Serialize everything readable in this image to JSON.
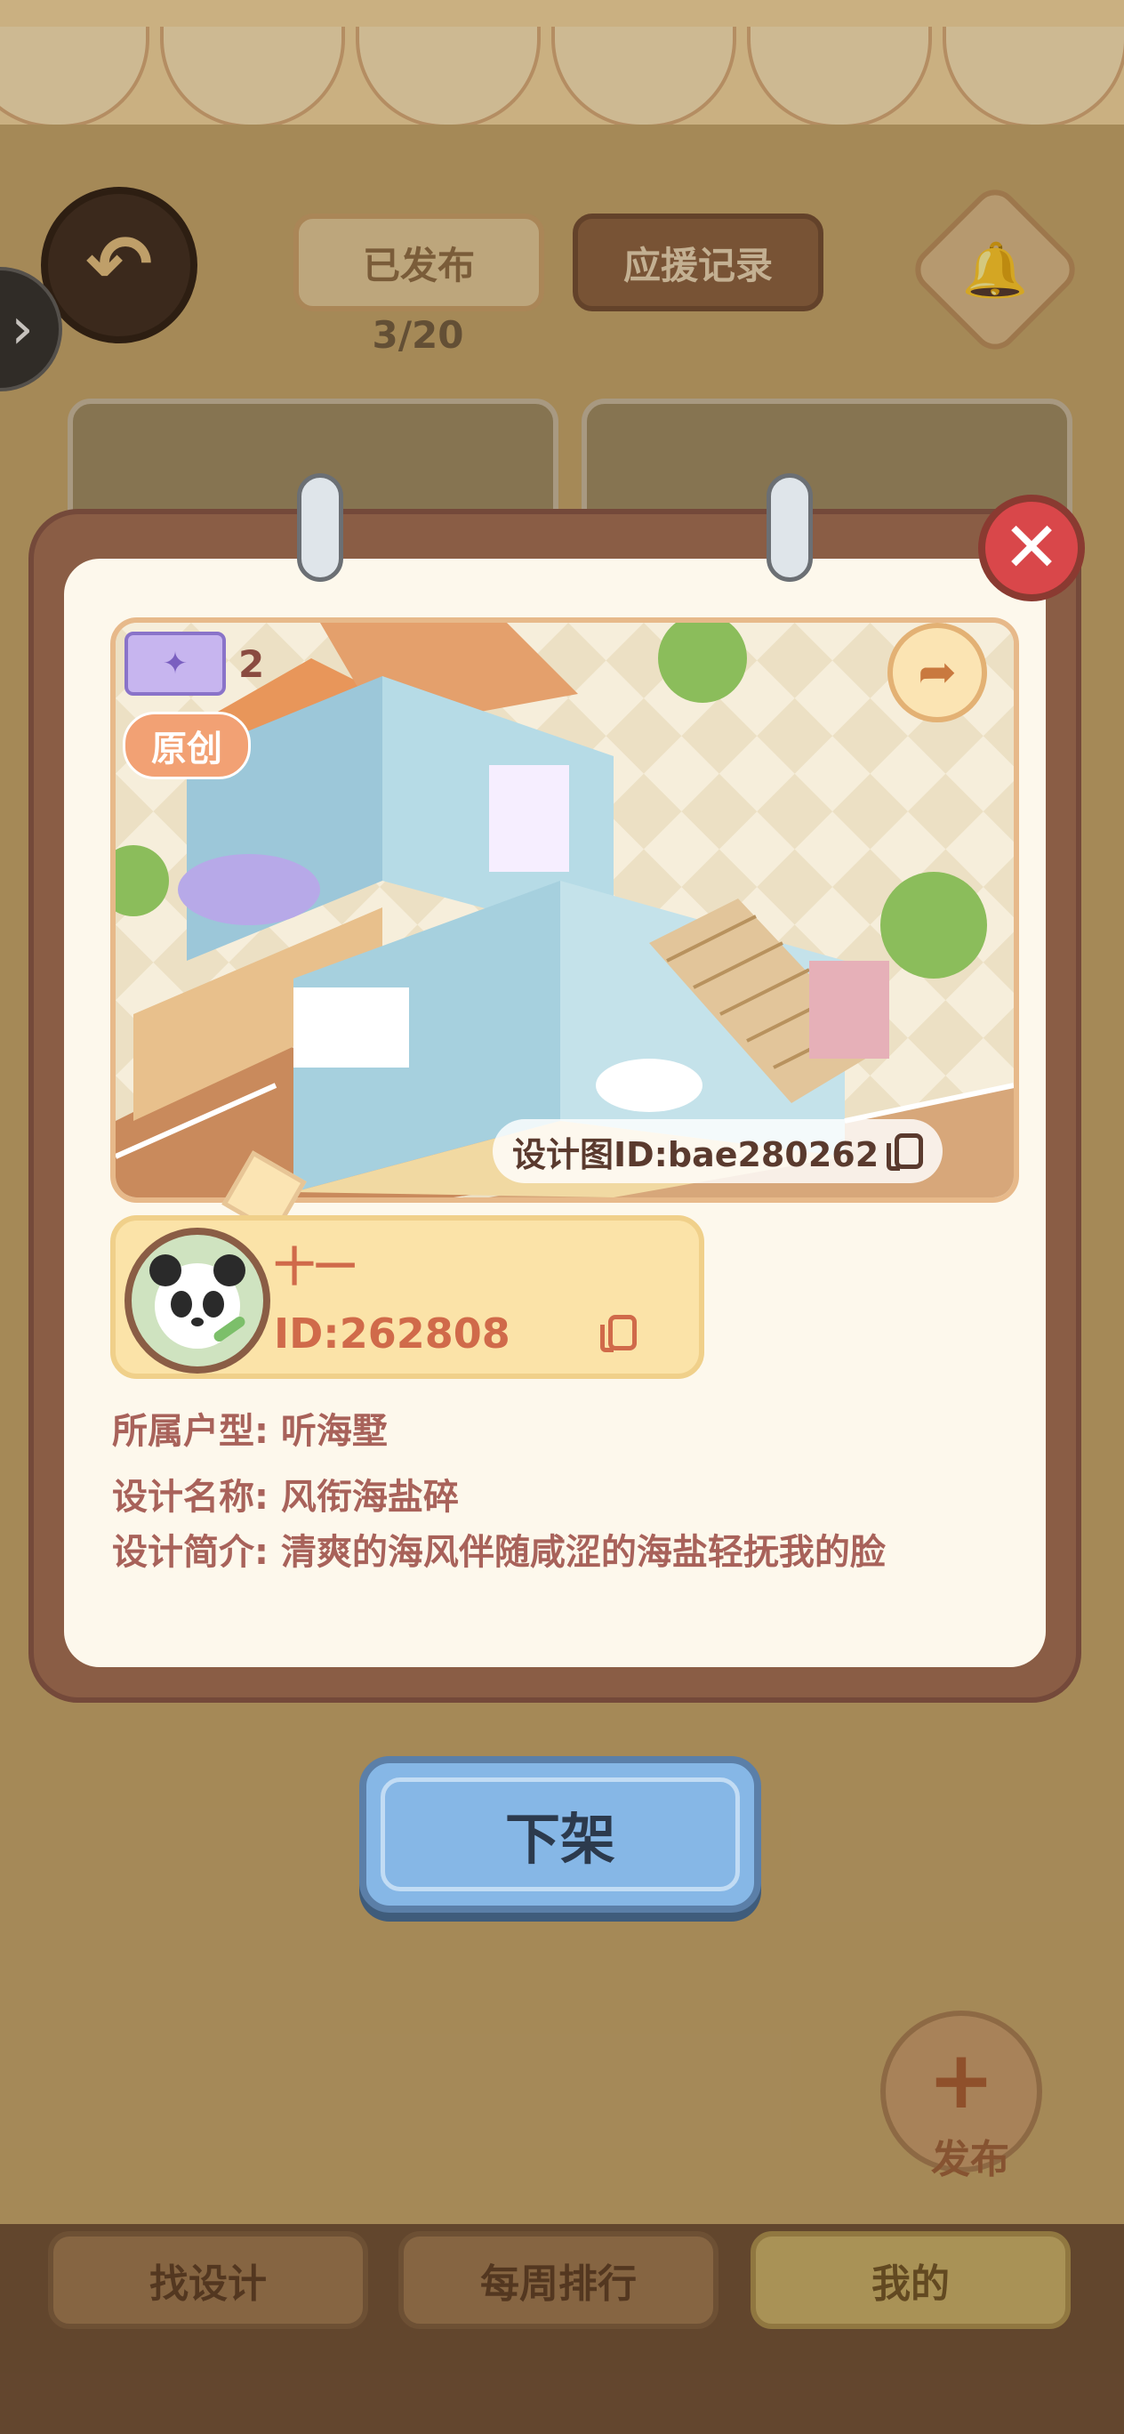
{
  "top_tabs": {
    "published": "已发布",
    "support_records": "应援记录"
  },
  "publish_count": "3/20",
  "publish_button_label": "发布",
  "bottom_nav": [
    "找设计",
    "每周排行",
    "我的"
  ],
  "design": {
    "ticket_count": "2",
    "original_badge": "原创",
    "design_id_text": "设计图ID:bae280262",
    "author_name": "十一",
    "author_id": "ID:262808",
    "house_type": "所属户型: 听海墅",
    "design_name": "设计名称: 风衔海盐碎",
    "design_intro": "设计简介: 清爽的海风伴随咸涩的海盐轻抚我的脸"
  },
  "remove_button_label": "下架",
  "icons": [
    "back-arrow-icon",
    "expand-chevron-icon",
    "bell-icon",
    "close-icon",
    "share-icon",
    "ticket-icon",
    "copy-icon",
    "plus-icon"
  ],
  "colors": {
    "modal_frame": "#8a5d45",
    "panel": "#fdf8ec",
    "accent_text": "#d06a4a",
    "remove_button": "#86b7e6",
    "close_button": "#d9474a"
  }
}
